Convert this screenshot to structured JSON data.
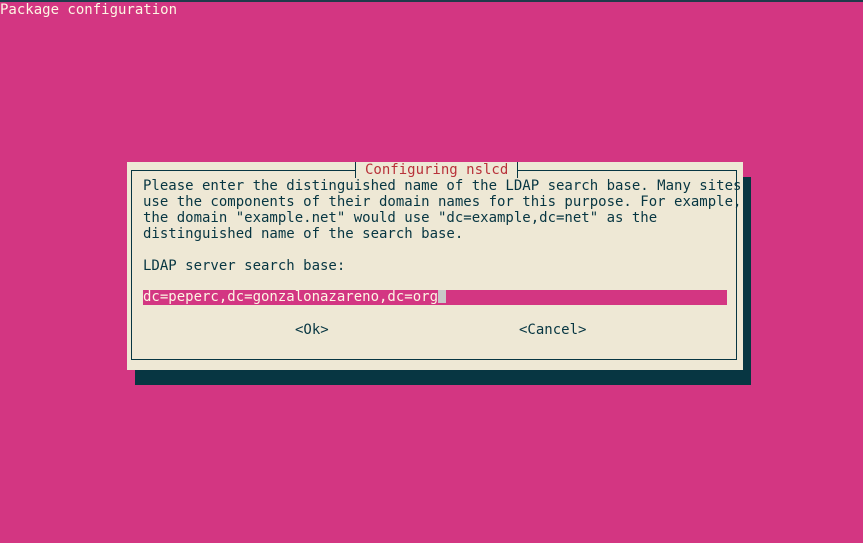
{
  "screen": {
    "title": "Package configuration"
  },
  "dialog": {
    "title": "Configuring nslcd",
    "description": [
      "Please enter the distinguished name of the LDAP search base. Many sites",
      "use the components of their domain names for this purpose. For example,",
      "the domain \"example.net\" would use \"dc=example,dc=net\" as the",
      "distinguished name of the search base."
    ],
    "field_label": "LDAP server search base:",
    "field_value": "dc=peperc,dc=gonzalonazareno,dc=org",
    "ok_label": "<Ok>",
    "cancel_label": "<Cancel>"
  },
  "colors": {
    "background": "#d33682",
    "dialog": "#eee8d5",
    "dialog_title": "#b8323a",
    "text": "#073642",
    "shadow": "#073642"
  }
}
